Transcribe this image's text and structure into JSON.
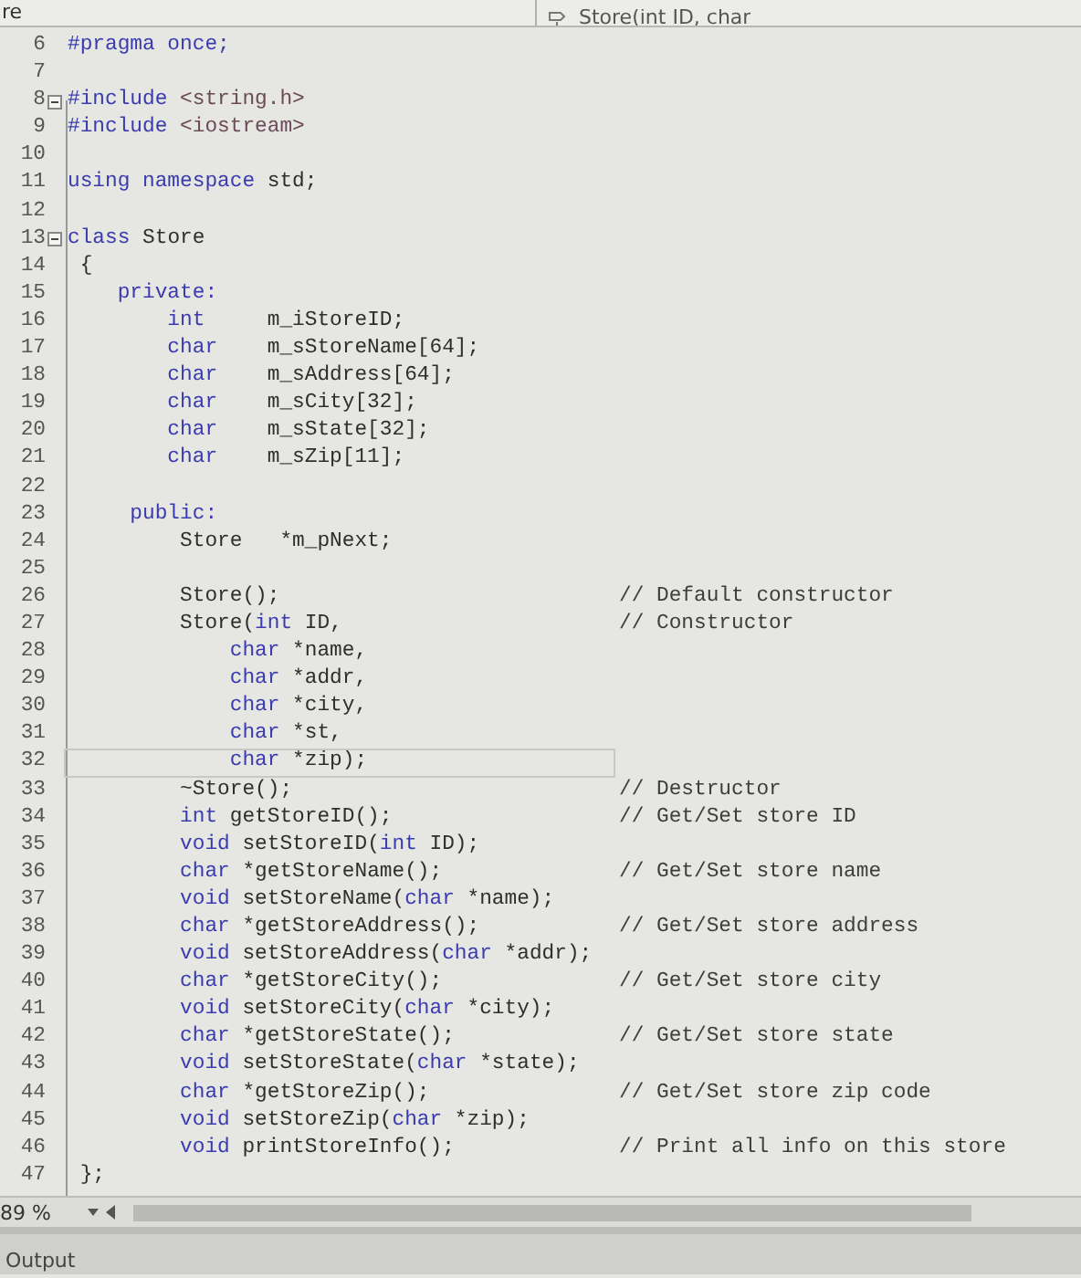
{
  "navigation_bar": {
    "file_label": "re",
    "member_dropdown": "Store(int ID, char"
  },
  "editor": {
    "lines": [
      {
        "number": "6",
        "current": false,
        "tokens": [
          {
            "kind": "keyword",
            "text": "#pragma once;"
          }
        ]
      },
      {
        "number": "7",
        "current": false
      },
      {
        "number": "8",
        "current": false,
        "expanded": true,
        "tokens": [
          {
            "kind": "keyword",
            "text": "#include"
          },
          {
            "kind": "string",
            "text": " <string.h>"
          }
        ]
      },
      {
        "number": "9",
        "current": false,
        "tokens": [
          {
            "kind": "keyword",
            "text": "#include"
          },
          {
            "kind": "string",
            "text": " <iostream>"
          }
        ]
      },
      {
        "number": "10",
        "current": false
      },
      {
        "number": "11",
        "current": false,
        "tokens": [
          {
            "kind": "keyword",
            "text": "using namespace"
          },
          {
            "kind": "plain",
            "text": " std;"
          }
        ]
      },
      {
        "number": "12",
        "current": false
      },
      {
        "number": "13",
        "current": false,
        "expanded": true,
        "tokens": [
          {
            "kind": "keyword",
            "text": "class"
          },
          {
            "kind": "plain",
            "text": " Store"
          }
        ]
      },
      {
        "number": "14",
        "current": false,
        "tokens": [
          {
            "kind": "plain",
            "text": " {"
          }
        ]
      },
      {
        "number": "15",
        "current": false,
        "tokens": [
          {
            "kind": "keyword",
            "text": "    private:"
          }
        ]
      },
      {
        "number": "16",
        "current": false,
        "tokens": [
          {
            "kind": "keyword",
            "text": "        int"
          },
          {
            "kind": "plain",
            "text": "     m_iStoreID;"
          }
        ]
      },
      {
        "number": "17",
        "current": false,
        "tokens": [
          {
            "kind": "keyword",
            "text": "        char"
          },
          {
            "kind": "plain",
            "text": "    m_sStoreName[64];"
          }
        ]
      },
      {
        "number": "18",
        "current": false,
        "tokens": [
          {
            "kind": "keyword",
            "text": "        char"
          },
          {
            "kind": "plain",
            "text": "    m_sAddress[64];"
          }
        ]
      },
      {
        "number": "19",
        "current": false,
        "tokens": [
          {
            "kind": "keyword",
            "text": "        char"
          },
          {
            "kind": "plain",
            "text": "    m_sCity[32];"
          }
        ]
      },
      {
        "number": "20",
        "current": false,
        "tokens": [
          {
            "kind": "keyword",
            "text": "        char"
          },
          {
            "kind": "plain",
            "text": "    m_sState[32];"
          }
        ]
      },
      {
        "number": "21",
        "current": false,
        "tokens": [
          {
            "kind": "keyword",
            "text": "        char"
          },
          {
            "kind": "plain",
            "text": "    m_sZip[11];"
          }
        ]
      },
      {
        "number": "22",
        "current": false
      },
      {
        "number": "23",
        "current": false,
        "tokens": [
          {
            "kind": "keyword",
            "text": "     public:"
          }
        ]
      },
      {
        "number": "24",
        "current": false,
        "tokens": [
          {
            "kind": "plain",
            "text": "         Store   *m_pNext;"
          }
        ]
      },
      {
        "number": "25",
        "current": false
      },
      {
        "number": "26",
        "current": false,
        "tokens": [
          {
            "kind": "plain",
            "text": "         Store();"
          }
        ],
        "comment": "// Default constructor"
      },
      {
        "number": "27",
        "current": false,
        "tokens": [
          {
            "kind": "plain",
            "text": "         Store("
          },
          {
            "kind": "keyword",
            "text": "int"
          },
          {
            "kind": "plain",
            "text": " ID,"
          }
        ],
        "comment": "// Constructor"
      },
      {
        "number": "28",
        "current": false,
        "tokens": [
          {
            "kind": "keyword",
            "text": "             char"
          },
          {
            "kind": "plain",
            "text": " *name,"
          }
        ]
      },
      {
        "number": "29",
        "current": false,
        "tokens": [
          {
            "kind": "keyword",
            "text": "             char"
          },
          {
            "kind": "plain",
            "text": " *addr,"
          }
        ]
      },
      {
        "number": "30",
        "current": false,
        "tokens": [
          {
            "kind": "keyword",
            "text": "             char"
          },
          {
            "kind": "plain",
            "text": " *city,"
          }
        ]
      },
      {
        "number": "31",
        "current": false,
        "tokens": [
          {
            "kind": "keyword",
            "text": "             char"
          },
          {
            "kind": "plain",
            "text": " *st,"
          }
        ]
      },
      {
        "number": "32",
        "current": true,
        "tokens": [
          {
            "kind": "keyword",
            "text": "             char"
          },
          {
            "kind": "plain",
            "text": " *zip);"
          }
        ]
      },
      {
        "number": "33",
        "current": false,
        "tokens": [
          {
            "kind": "plain",
            "text": "         ~Store();"
          }
        ],
        "comment": "// Destructor"
      },
      {
        "number": "34",
        "current": false,
        "tokens": [
          {
            "kind": "keyword",
            "text": "         int"
          },
          {
            "kind": "plain",
            "text": " getStoreID();"
          }
        ],
        "comment": "// Get/Set store ID"
      },
      {
        "number": "35",
        "current": false,
        "tokens": [
          {
            "kind": "keyword",
            "text": "         void"
          },
          {
            "kind": "plain",
            "text": " setStoreID("
          },
          {
            "kind": "keyword",
            "text": "int"
          },
          {
            "kind": "plain",
            "text": " ID);"
          }
        ]
      },
      {
        "number": "36",
        "current": false,
        "tokens": [
          {
            "kind": "keyword",
            "text": "         char"
          },
          {
            "kind": "plain",
            "text": " *getStoreName();"
          }
        ],
        "comment": "// Get/Set store name"
      },
      {
        "number": "37",
        "current": false,
        "tokens": [
          {
            "kind": "keyword",
            "text": "         void"
          },
          {
            "kind": "plain",
            "text": " setStoreName("
          },
          {
            "kind": "keyword",
            "text": "char"
          },
          {
            "kind": "plain",
            "text": " *name);"
          }
        ]
      },
      {
        "number": "38",
        "current": false,
        "tokens": [
          {
            "kind": "keyword",
            "text": "         char"
          },
          {
            "kind": "plain",
            "text": " *getStoreAddress();"
          }
        ],
        "comment": "// Get/Set store address"
      },
      {
        "number": "39",
        "current": false,
        "tokens": [
          {
            "kind": "keyword",
            "text": "         void"
          },
          {
            "kind": "plain",
            "text": " setStoreAddress("
          },
          {
            "kind": "keyword",
            "text": "char"
          },
          {
            "kind": "plain",
            "text": " *addr);"
          }
        ]
      },
      {
        "number": "40",
        "current": false,
        "tokens": [
          {
            "kind": "keyword",
            "text": "         char"
          },
          {
            "kind": "plain",
            "text": " *getStoreCity();"
          }
        ],
        "comment": "// Get/Set store city"
      },
      {
        "number": "41",
        "current": false,
        "tokens": [
          {
            "kind": "keyword",
            "text": "         void"
          },
          {
            "kind": "plain",
            "text": " setStoreCity("
          },
          {
            "kind": "keyword",
            "text": "char"
          },
          {
            "kind": "plain",
            "text": " *city);"
          }
        ]
      },
      {
        "number": "42",
        "current": false,
        "tokens": [
          {
            "kind": "keyword",
            "text": "         char"
          },
          {
            "kind": "plain",
            "text": " *getStoreState();"
          }
        ],
        "comment": "// Get/Set store state"
      },
      {
        "number": "43",
        "current": false,
        "tokens": [
          {
            "kind": "keyword",
            "text": "         void"
          },
          {
            "kind": "plain",
            "text": " setStoreState("
          },
          {
            "kind": "keyword",
            "text": "char"
          },
          {
            "kind": "plain",
            "text": " *state);"
          }
        ]
      },
      {
        "number": "44",
        "current": false,
        "tokens": [
          {
            "kind": "keyword",
            "text": "         char"
          },
          {
            "kind": "plain",
            "text": " *getStoreZip();"
          }
        ],
        "comment": "// Get/Set store zip code"
      },
      {
        "number": "45",
        "current": false,
        "tokens": [
          {
            "kind": "keyword",
            "text": "         void"
          },
          {
            "kind": "plain",
            "text": " setStoreZip("
          },
          {
            "kind": "keyword",
            "text": "char"
          },
          {
            "kind": "plain",
            "text": " *zip);"
          }
        ]
      },
      {
        "number": "46",
        "current": false,
        "tokens": [
          {
            "kind": "keyword",
            "text": "         void"
          },
          {
            "kind": "plain",
            "text": " printStoreInfo();"
          }
        ],
        "comment": "// Print all info on this store"
      },
      {
        "number": "47",
        "current": false,
        "tokens": [
          {
            "kind": "plain",
            "text": " };"
          }
        ]
      }
    ]
  },
  "status_bar": {
    "zoom": "89 %"
  },
  "output_panel": {
    "title": "Output"
  }
}
